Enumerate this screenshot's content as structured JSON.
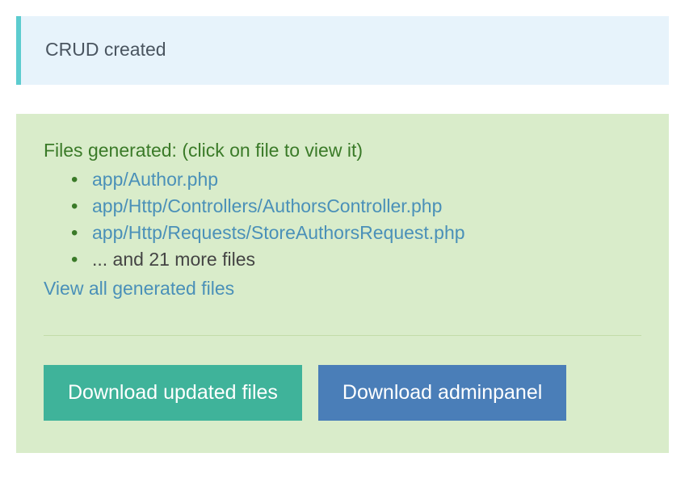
{
  "info_banner": {
    "message": "CRUD created"
  },
  "success": {
    "heading": "Files generated: (click on file to view it)",
    "files": {
      "0": "app/Author.php",
      "1": "app/Http/Controllers/AuthorsController.php",
      "2": "app/Http/Requests/StoreAuthorsRequest.php"
    },
    "more_text": "... and 21 more files",
    "view_all_label": "View all generated files"
  },
  "buttons": {
    "download_updated": "Download updated files",
    "download_adminpanel": "Download adminpanel"
  }
}
